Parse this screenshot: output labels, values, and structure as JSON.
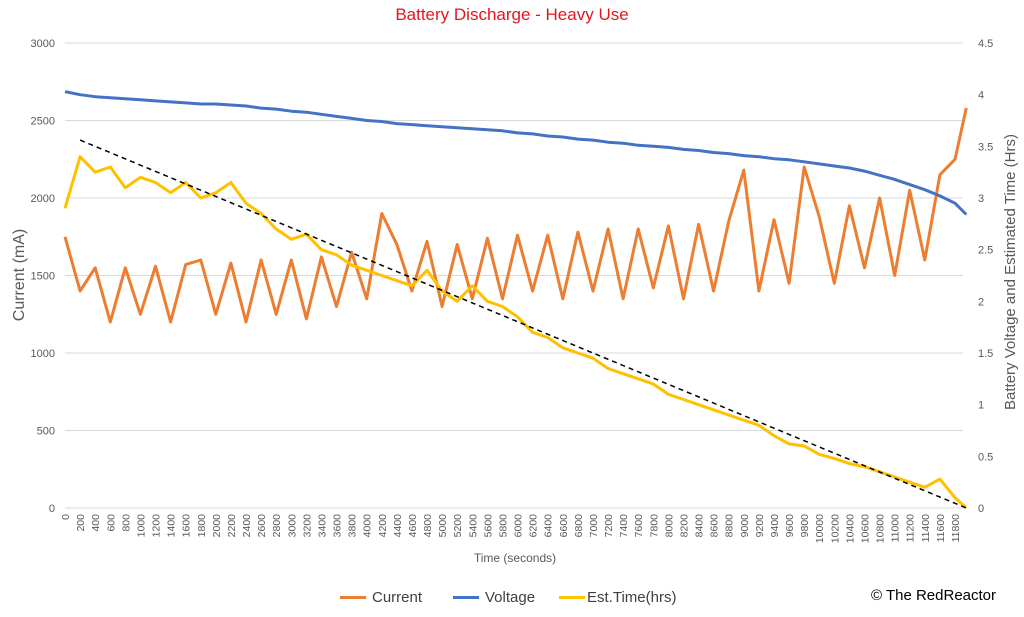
{
  "chart_data": {
    "type": "line",
    "title": "Battery Discharge - Heavy Use",
    "xlabel": "Time (seconds)",
    "ylabel_left": "Current (mA)",
    "ylabel_right": "Battery Voltage and Estimated Time (Hrs)",
    "xlim": [
      0,
      11950
    ],
    "ylim_left": [
      0,
      3000
    ],
    "ylim_right": [
      0,
      4.5
    ],
    "x_ticks": [
      "0",
      "200",
      "400",
      "600",
      "800",
      "1000",
      "1200",
      "1400",
      "1600",
      "1800",
      "2000",
      "2200",
      "2400",
      "2600",
      "2800",
      "3000",
      "3200",
      "3400",
      "3600",
      "3800",
      "4000",
      "4200",
      "4400",
      "4600",
      "4800",
      "5000",
      "5200",
      "5400",
      "5600",
      "5800",
      "6000",
      "6200",
      "6400",
      "6600",
      "6800",
      "7000",
      "7200",
      "7400",
      "7600",
      "7800",
      "8000",
      "8200",
      "8400",
      "8600",
      "8800",
      "9000",
      "9200",
      "9400",
      "9600",
      "9800",
      "10000",
      "10200",
      "10400",
      "10600",
      "10800",
      "11000",
      "11200",
      "11400",
      "11600",
      "11800"
    ],
    "y_ticks_left": [
      "0",
      "500",
      "1000",
      "1500",
      "2000",
      "2500",
      "3000"
    ],
    "y_ticks_right": [
      "0",
      "0.5",
      "1",
      "1.5",
      "2",
      "2.5",
      "3",
      "3.5",
      "4",
      "4.5"
    ],
    "grid": true,
    "legend_position": "bottom",
    "x": [
      0,
      200,
      400,
      600,
      800,
      1000,
      1200,
      1400,
      1600,
      1800,
      2000,
      2200,
      2400,
      2600,
      2800,
      3000,
      3200,
      3400,
      3600,
      3800,
      4000,
      4200,
      4400,
      4600,
      4800,
      5000,
      5200,
      5400,
      5600,
      5800,
      6000,
      6200,
      6400,
      6600,
      6800,
      7000,
      7200,
      7400,
      7600,
      7800,
      8000,
      8200,
      8400,
      8600,
      8800,
      9000,
      9200,
      9400,
      9600,
      9800,
      10000,
      10200,
      10400,
      10600,
      10800,
      11000,
      11200,
      11400,
      11600,
      11800,
      11950
    ],
    "series": [
      {
        "name": "Current",
        "axis": "left",
        "color": "#ed7d31",
        "values": [
          1750,
          1400,
          1550,
          1200,
          1550,
          1250,
          1560,
          1200,
          1570,
          1600,
          1250,
          1580,
          1200,
          1600,
          1250,
          1600,
          1220,
          1620,
          1300,
          1650,
          1350,
          1900,
          1700,
          1400,
          1720,
          1300,
          1700,
          1350,
          1740,
          1350,
          1760,
          1400,
          1760,
          1350,
          1780,
          1400,
          1800,
          1350,
          1800,
          1420,
          1820,
          1350,
          1830,
          1400,
          1850,
          2180,
          1400,
          1860,
          1450,
          2200,
          1880,
          1450,
          1950,
          1550,
          2000,
          1500,
          2050,
          1600,
          2150,
          2250,
          2580
        ]
      },
      {
        "name": "Voltage",
        "axis": "right",
        "color": "#4472c4",
        "values": [
          4.03,
          4.0,
          3.98,
          3.97,
          3.96,
          3.95,
          3.94,
          3.93,
          3.92,
          3.91,
          3.91,
          3.9,
          3.89,
          3.87,
          3.86,
          3.84,
          3.83,
          3.81,
          3.79,
          3.77,
          3.75,
          3.74,
          3.72,
          3.71,
          3.7,
          3.69,
          3.68,
          3.67,
          3.66,
          3.65,
          3.63,
          3.62,
          3.6,
          3.59,
          3.57,
          3.56,
          3.54,
          3.53,
          3.51,
          3.5,
          3.49,
          3.47,
          3.46,
          3.44,
          3.43,
          3.41,
          3.4,
          3.38,
          3.37,
          3.35,
          3.33,
          3.31,
          3.29,
          3.26,
          3.22,
          3.18,
          3.13,
          3.08,
          3.02,
          2.95,
          2.84
        ]
      },
      {
        "name": "Est.Time(hrs)",
        "axis": "right",
        "color": "#ffc000",
        "values": [
          2.9,
          3.4,
          3.25,
          3.3,
          3.1,
          3.2,
          3.15,
          3.05,
          3.15,
          3.0,
          3.05,
          3.15,
          2.95,
          2.85,
          2.7,
          2.6,
          2.65,
          2.5,
          2.45,
          2.35,
          2.3,
          2.25,
          2.2,
          2.15,
          2.3,
          2.1,
          2.0,
          2.15,
          2.0,
          1.95,
          1.85,
          1.7,
          1.65,
          1.55,
          1.5,
          1.45,
          1.35,
          1.3,
          1.25,
          1.2,
          1.1,
          1.05,
          1.0,
          0.95,
          0.9,
          0.85,
          0.8,
          0.7,
          0.62,
          0.6,
          0.52,
          0.48,
          0.43,
          0.4,
          0.35,
          0.3,
          0.25,
          0.2,
          0.28,
          0.1,
          0.0
        ]
      },
      {
        "axis": "right",
        "color": "#000000",
        "style": "dashed-trendline",
        "x": [
          200,
          11950
        ],
        "values": [
          3.56,
          0.0
        ]
      }
    ]
  },
  "legend": [
    {
      "label": "Current",
      "color": "#ed7d31"
    },
    {
      "label": "Voltage",
      "color": "#4472c4"
    },
    {
      "label": "Est.Time(hrs)",
      "color": "#ffc000"
    }
  ],
  "copyright": "© The RedReactor"
}
